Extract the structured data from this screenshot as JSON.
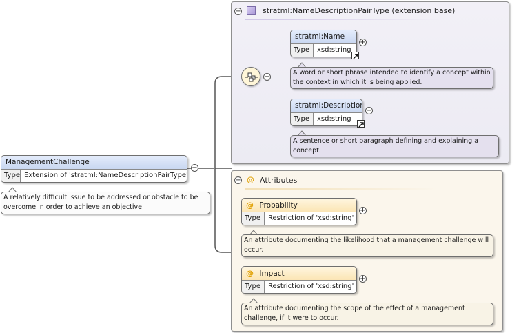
{
  "root": {
    "name": "ManagementChallenge",
    "type_label": "Type",
    "type_value": "Extension of 'stratml:NameDescriptionPairType'",
    "doc": "A relatively difficult issue to be addressed or obstacle to be overcome in order to achieve an objective."
  },
  "extension": {
    "header": "stratml:NameDescriptionPairType (extension base)",
    "elements": [
      {
        "name": "stratml:Name",
        "type_label": "Type",
        "type_value": "xsd:string",
        "doc": "A word or short phrase intended to identify a concept within the context in which it is being applied."
      },
      {
        "name": "stratml:Description",
        "type_label": "Type",
        "type_value": "xsd:string",
        "doc": "A sentence or short paragraph defining and explaining a concept."
      }
    ]
  },
  "attributes": {
    "header": "Attributes",
    "at_symbol": "@",
    "items": [
      {
        "name": "Probability",
        "type_label": "Type",
        "type_value": "Restriction of 'xsd:string'",
        "doc": "An attribute documenting the likelihood that a management challenge will occur."
      },
      {
        "name": "Impact",
        "type_label": "Type",
        "type_value": "Restriction of 'xsd:string'",
        "doc": "An attribute documenting the scope of the effect of a management challenge, if it were to occur."
      }
    ]
  },
  "icons": {
    "collapse": "minus-circle-icon",
    "expand": "plus-circle-icon",
    "sequence": "sequence-compositor-icon",
    "complex_type": "complex-type-icon",
    "goto_type": "goto-type-arrow-icon"
  },
  "colors": {
    "element_header": "#c9d7f1",
    "attribute_header": "#fbe5b4",
    "extension_panel": "#ecebf3",
    "attributes_panel": "#fbf6ec",
    "doc_element": "#e4e0ee",
    "doc_attribute": "#f8f3e6",
    "at_symbol": "#e0a000"
  }
}
